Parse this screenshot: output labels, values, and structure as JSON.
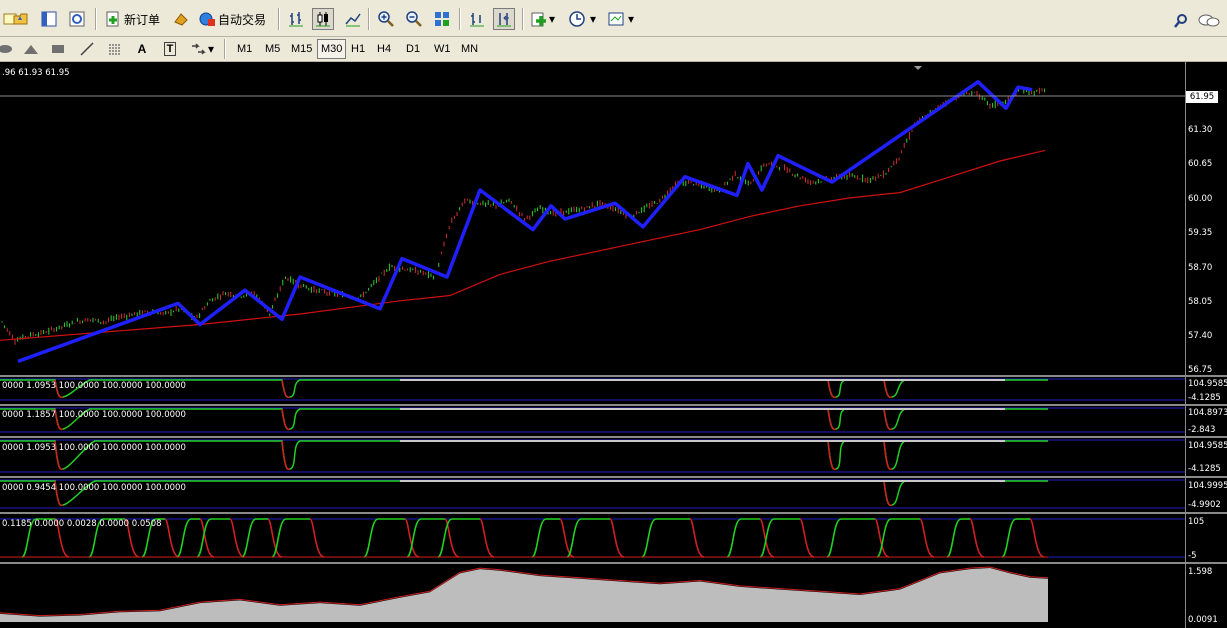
{
  "toolbar": {
    "new_order_label": "新订单",
    "auto_trade_label": "自动交易",
    "icons": [
      "new-chart-icon",
      "profiles-icon",
      "market-watch-icon",
      "navigator-icon",
      "new-order-icon",
      "expert-advisors-icon",
      "auto-trading-icon",
      "bar-chart-icon",
      "candlestick-icon",
      "line-chart-icon",
      "zoom-in-icon",
      "zoom-out-icon",
      "tile-windows-icon",
      "chart-shift-icon",
      "autoscroll-icon",
      "indicators-icon",
      "periods-icon",
      "templates-icon",
      "search-icon",
      "chat-icon"
    ]
  },
  "drawing_tools": {
    "text_tool": "A",
    "text_label_tool": "T"
  },
  "timeframes": {
    "items": [
      "M1",
      "M5",
      "M15",
      "M30",
      "H1",
      "H4",
      "D1",
      "W1",
      "MN"
    ],
    "active": "M30"
  },
  "main_chart": {
    "ohlc_label": ".96 61.93 61.95",
    "current_price": "61.95",
    "y_ticks": [
      "61.30",
      "60.65",
      "60.00",
      "59.35",
      "58.70",
      "58.05",
      "57.40",
      "56.75"
    ]
  },
  "indicators": [
    {
      "label": "0000 1.0953 100.0000 100.0000 100.0000",
      "top": "104.9585",
      "bottom": "-4.1285"
    },
    {
      "label": "0000 1.1857 100.0000 100.0000 100.0000",
      "top": "104.8973",
      "bottom": "-2.843"
    },
    {
      "label": "0000 1.0953 100.0000 100.0000 100.0000",
      "top": "104.9585",
      "bottom": "-4.1285"
    },
    {
      "label": "0000 0.9454 100.0000 100.0000 100.0000",
      "top": "104.9995",
      "bottom": "-4.9902"
    },
    {
      "label": "0.1185 0.0000 0.0028 0.0000 0.0508",
      "top": "105",
      "bottom": "-5"
    },
    {
      "label": "",
      "top": "1.598",
      "bottom": "0.0091"
    }
  ],
  "chart_data": {
    "type": "line",
    "series": [
      {
        "kind": "price",
        "x": [
          0,
          15,
          30,
          45,
          60,
          75,
          90,
          105,
          120,
          135,
          150,
          165,
          180,
          195,
          210,
          225,
          240,
          255,
          270,
          285,
          300,
          315,
          330,
          345,
          360,
          375,
          390,
          405,
          420,
          435,
          450,
          465,
          480,
          495,
          510,
          525,
          540,
          555,
          570,
          585,
          600,
          615,
          630,
          645,
          660,
          675,
          690,
          705,
          720,
          735,
          750,
          765,
          780,
          795,
          810,
          825,
          840,
          855,
          870,
          885,
          900,
          915,
          930,
          945,
          960,
          975,
          990,
          1005,
          1020,
          1035,
          1045
        ],
        "values": [
          57.6,
          57.2,
          57.3,
          57.35,
          57.45,
          57.55,
          57.6,
          57.55,
          57.65,
          57.7,
          57.75,
          57.7,
          57.8,
          57.6,
          57.95,
          58.1,
          58.05,
          58.1,
          57.7,
          58.4,
          58.25,
          58.15,
          58.1,
          58.05,
          58.0,
          58.3,
          58.6,
          58.55,
          58.5,
          58.4,
          59.4,
          59.85,
          59.8,
          59.75,
          59.85,
          59.5,
          59.7,
          59.6,
          59.65,
          59.7,
          59.8,
          59.7,
          59.55,
          59.7,
          59.85,
          60.15,
          60.2,
          60.1,
          60.05,
          60.35,
          60.15,
          60.55,
          60.5,
          60.35,
          60.2,
          60.25,
          60.3,
          60.3,
          60.25,
          60.35,
          60.7,
          61.3,
          61.5,
          61.7,
          61.85,
          61.9,
          61.65,
          61.7,
          61.95,
          61.9,
          61.95
        ]
      },
      {
        "kind": "ma",
        "x": [
          0,
          100,
          200,
          300,
          400,
          450,
          500,
          550,
          600,
          650,
          700,
          750,
          800,
          850,
          900,
          950,
          1000,
          1045
        ],
        "values": [
          57.2,
          57.35,
          57.5,
          57.7,
          57.95,
          58.05,
          58.45,
          58.7,
          58.9,
          59.1,
          59.3,
          59.55,
          59.75,
          59.9,
          60.0,
          60.3,
          60.6,
          60.8
        ]
      },
      {
        "kind": "zigzag",
        "x": [
          18,
          178,
          200,
          245,
          282,
          300,
          380,
          402,
          447,
          480,
          533,
          551,
          565,
          615,
          643,
          685,
          737,
          748,
          762,
          778,
          832,
          978,
          1006,
          1018,
          1032
        ],
        "values": [
          56.8,
          57.9,
          57.5,
          58.15,
          57.6,
          58.4,
          57.8,
          58.75,
          58.4,
          60.05,
          59.3,
          59.75,
          59.5,
          59.8,
          59.35,
          60.3,
          59.95,
          60.55,
          60.05,
          60.7,
          60.2,
          62.1,
          61.6,
          62.0,
          61.95
        ]
      }
    ],
    "ylim": [
      56.6,
      62.4
    ],
    "xlim": [
      0,
      1185
    ]
  }
}
